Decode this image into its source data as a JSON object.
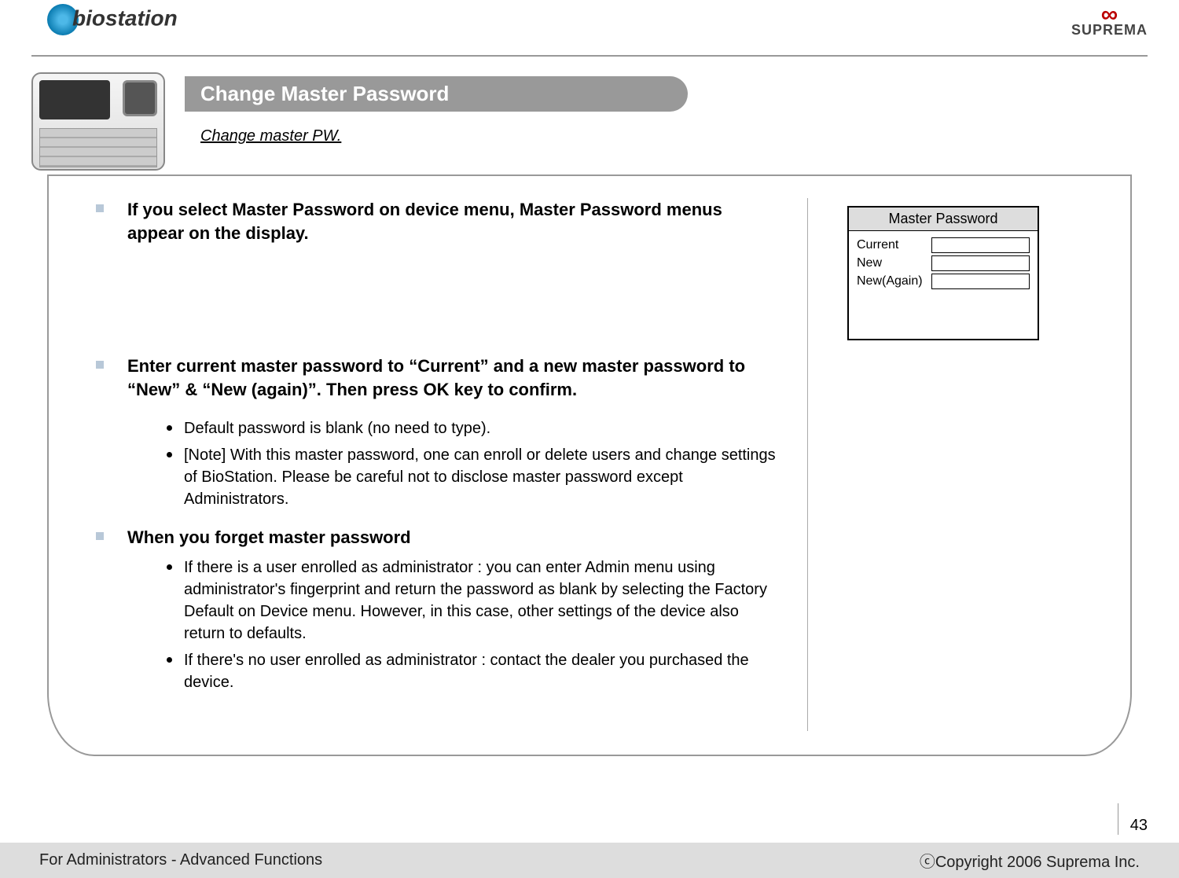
{
  "logos": {
    "left_text": "biostation",
    "right_text": "SUPREMA"
  },
  "title": "Change Master Password",
  "subtitle": "Change master PW.",
  "content": {
    "p1": "If you select Master Password on device menu, Master Password menus appear on the display.",
    "p2": "Enter current master password to “Current” and a new master password to “New” & “New (again)”. Then press OK key to confirm.",
    "p2_sub": [
      "Default password is blank (no need to type).",
      "[Note] With this master password, one can enroll or delete users and change settings of BioStation. Please be careful not to disclose master password except Administrators."
    ],
    "p3": "When you forget master password",
    "p3_sub": [
      "If there is a user enrolled as administrator : you can enter Admin menu using administrator's fingerprint and return the password as blank by selecting the Factory Default on Device menu. However, in this case, other settings of the device also return to defaults.",
      "If there's no user enrolled as administrator : contact the dealer you purchased the device."
    ]
  },
  "device_screen": {
    "title": "Master Password",
    "fields": [
      "Current",
      "New",
      "New(Again)"
    ]
  },
  "footer": {
    "left": "For Administrators - Advanced Functions",
    "right": "ⓒCopyright 2006 Suprema Inc."
  },
  "page_number": "43"
}
